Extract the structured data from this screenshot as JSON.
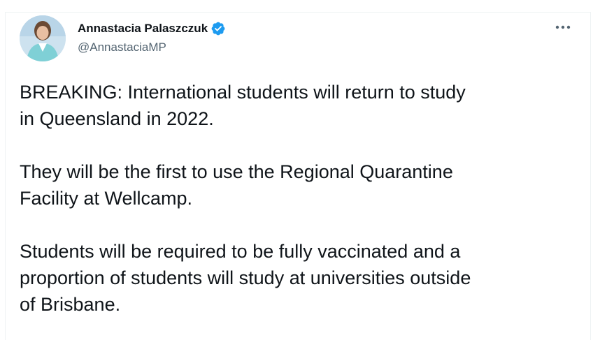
{
  "tweet": {
    "author": {
      "display_name": "Annastacia Palaszczuk",
      "handle": "@AnnastaciaMP",
      "verified": true,
      "avatar_icon": "profile-photo"
    },
    "more_icon": "ellipsis-icon",
    "text": "BREAKING: International students will return to study\nin Queensland in 2022.\n\nThey will be the first to use the Regional Quarantine\nFacility at Wellcamp.\n\nStudents will be required to be fully vaccinated and a\nproportion of students will study at universities outside\nof Brisbane."
  },
  "colors": {
    "text_primary": "#0f1419",
    "text_secondary": "#536471",
    "verified_blue": "#1d9bf0",
    "border": "#eff3f4"
  }
}
